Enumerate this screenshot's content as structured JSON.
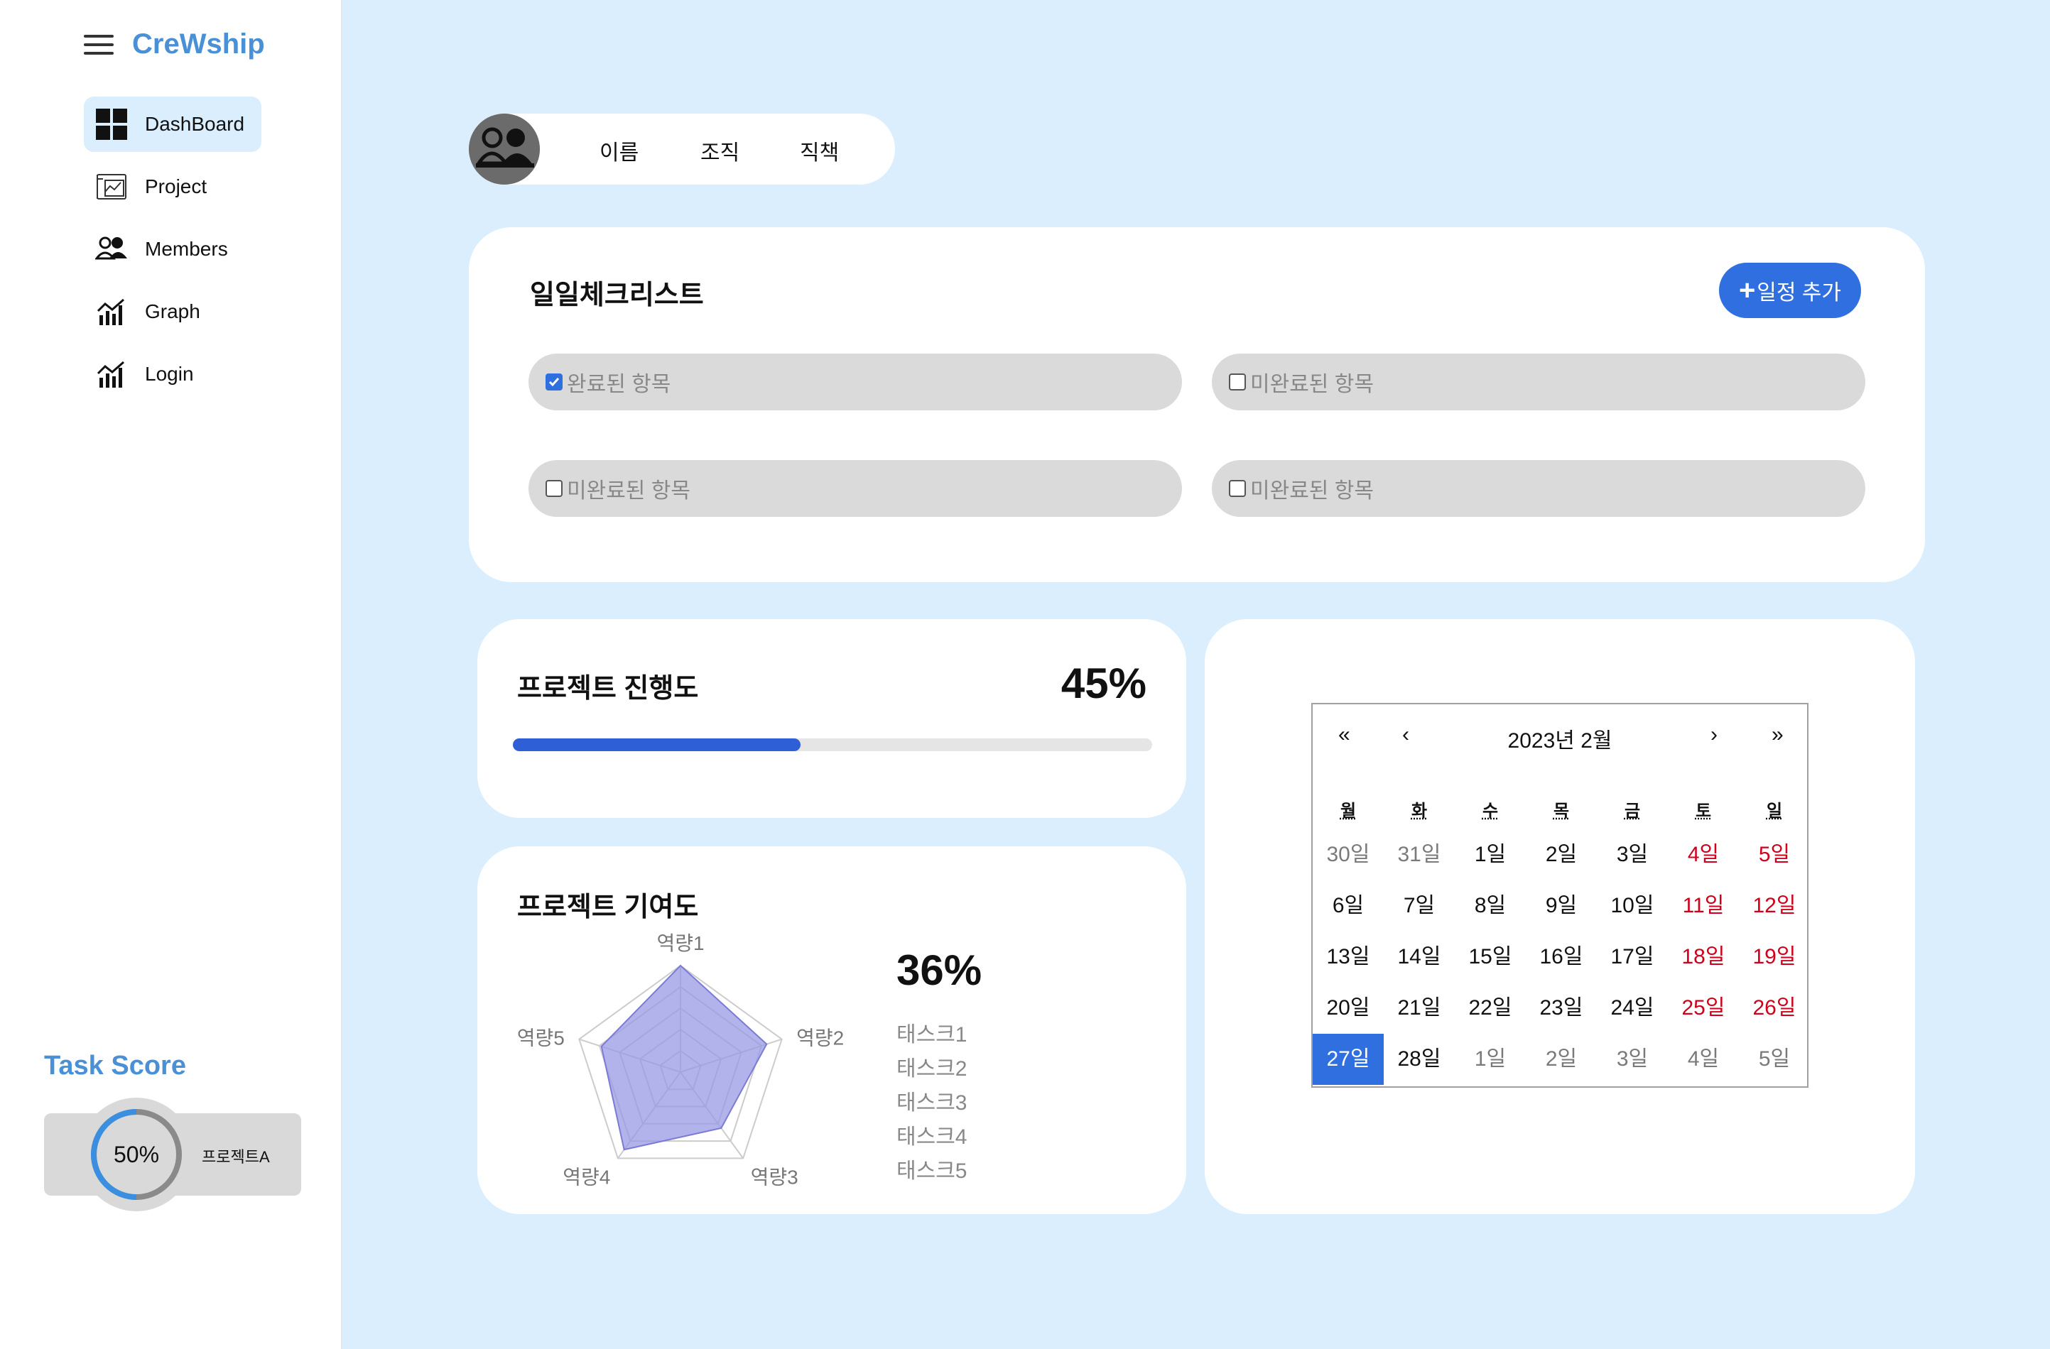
{
  "app": {
    "brand": "CreWship"
  },
  "sidebar": {
    "items": [
      {
        "label": "DashBoard",
        "icon": "dashboard-icon",
        "active": true
      },
      {
        "label": "Project",
        "icon": "project-icon",
        "active": false
      },
      {
        "label": "Members",
        "icon": "members-icon",
        "active": false
      },
      {
        "label": "Graph",
        "icon": "graph-icon",
        "active": false
      },
      {
        "label": "Login",
        "icon": "graph-icon",
        "active": false
      }
    ],
    "task_score": {
      "title": "Task Score",
      "percent_label": "50%",
      "percent": 50,
      "project": "프로젝트A"
    }
  },
  "profile": {
    "name_label": "이름",
    "org_label": "조직",
    "role_label": "직책"
  },
  "checklist": {
    "title": "일일체크리스트",
    "add_button_plus": "+",
    "add_button_label": "일정 추가",
    "items": [
      {
        "label": "완료된 항목",
        "checked": true
      },
      {
        "label": "미완료된 항목",
        "checked": false
      },
      {
        "label": "미완료된 항목",
        "checked": false
      },
      {
        "label": "미완료된 항목",
        "checked": false
      }
    ]
  },
  "progress": {
    "title": "프로젝트 진행도",
    "percent_label": "45%",
    "percent": 45
  },
  "contribution": {
    "title": "프로젝트 기여도",
    "percent_label": "36%",
    "tasks": [
      "태스크1",
      "태스크2",
      "태스크3",
      "태스크4",
      "태스크5"
    ],
    "radar_axes": [
      "역량1",
      "역량2",
      "역량3",
      "역량4",
      "역량5"
    ],
    "radar_values": [
      1.0,
      0.85,
      0.65,
      0.9,
      0.78
    ],
    "radar_max": 1.0,
    "radar_fill": "#9a9ae6"
  },
  "calendar": {
    "title": "2023년 2월",
    "nav": {
      "prev_year": "«",
      "prev_month": "‹",
      "next_month": "›",
      "next_year": "»"
    },
    "weekdays": [
      "월",
      "화",
      "수",
      "목",
      "금",
      "토",
      "일"
    ],
    "weeks": [
      [
        {
          "d": "30일",
          "o": true
        },
        {
          "d": "31일",
          "o": true
        },
        {
          "d": "1일"
        },
        {
          "d": "2일"
        },
        {
          "d": "3일"
        },
        {
          "d": "4일",
          "w": true
        },
        {
          "d": "5일",
          "w": true
        }
      ],
      [
        {
          "d": "6일"
        },
        {
          "d": "7일"
        },
        {
          "d": "8일"
        },
        {
          "d": "9일"
        },
        {
          "d": "10일"
        },
        {
          "d": "11일",
          "w": true
        },
        {
          "d": "12일",
          "w": true
        }
      ],
      [
        {
          "d": "13일"
        },
        {
          "d": "14일"
        },
        {
          "d": "15일"
        },
        {
          "d": "16일"
        },
        {
          "d": "17일"
        },
        {
          "d": "18일",
          "w": true
        },
        {
          "d": "19일",
          "w": true
        }
      ],
      [
        {
          "d": "20일"
        },
        {
          "d": "21일"
        },
        {
          "d": "22일"
        },
        {
          "d": "23일"
        },
        {
          "d": "24일"
        },
        {
          "d": "25일",
          "w": true
        },
        {
          "d": "26일",
          "w": true
        }
      ],
      [
        {
          "d": "27일",
          "t": true
        },
        {
          "d": "28일"
        },
        {
          "d": "1일",
          "o": true
        },
        {
          "d": "2일",
          "o": true
        },
        {
          "d": "3일",
          "o": true
        },
        {
          "d": "4일",
          "o": true
        },
        {
          "d": "5일",
          "o": true
        }
      ]
    ]
  },
  "colors": {
    "accent": "#2f6fe0",
    "brand": "#4a90d6",
    "weekend": "#d0021b",
    "background": "#dbeefd"
  }
}
